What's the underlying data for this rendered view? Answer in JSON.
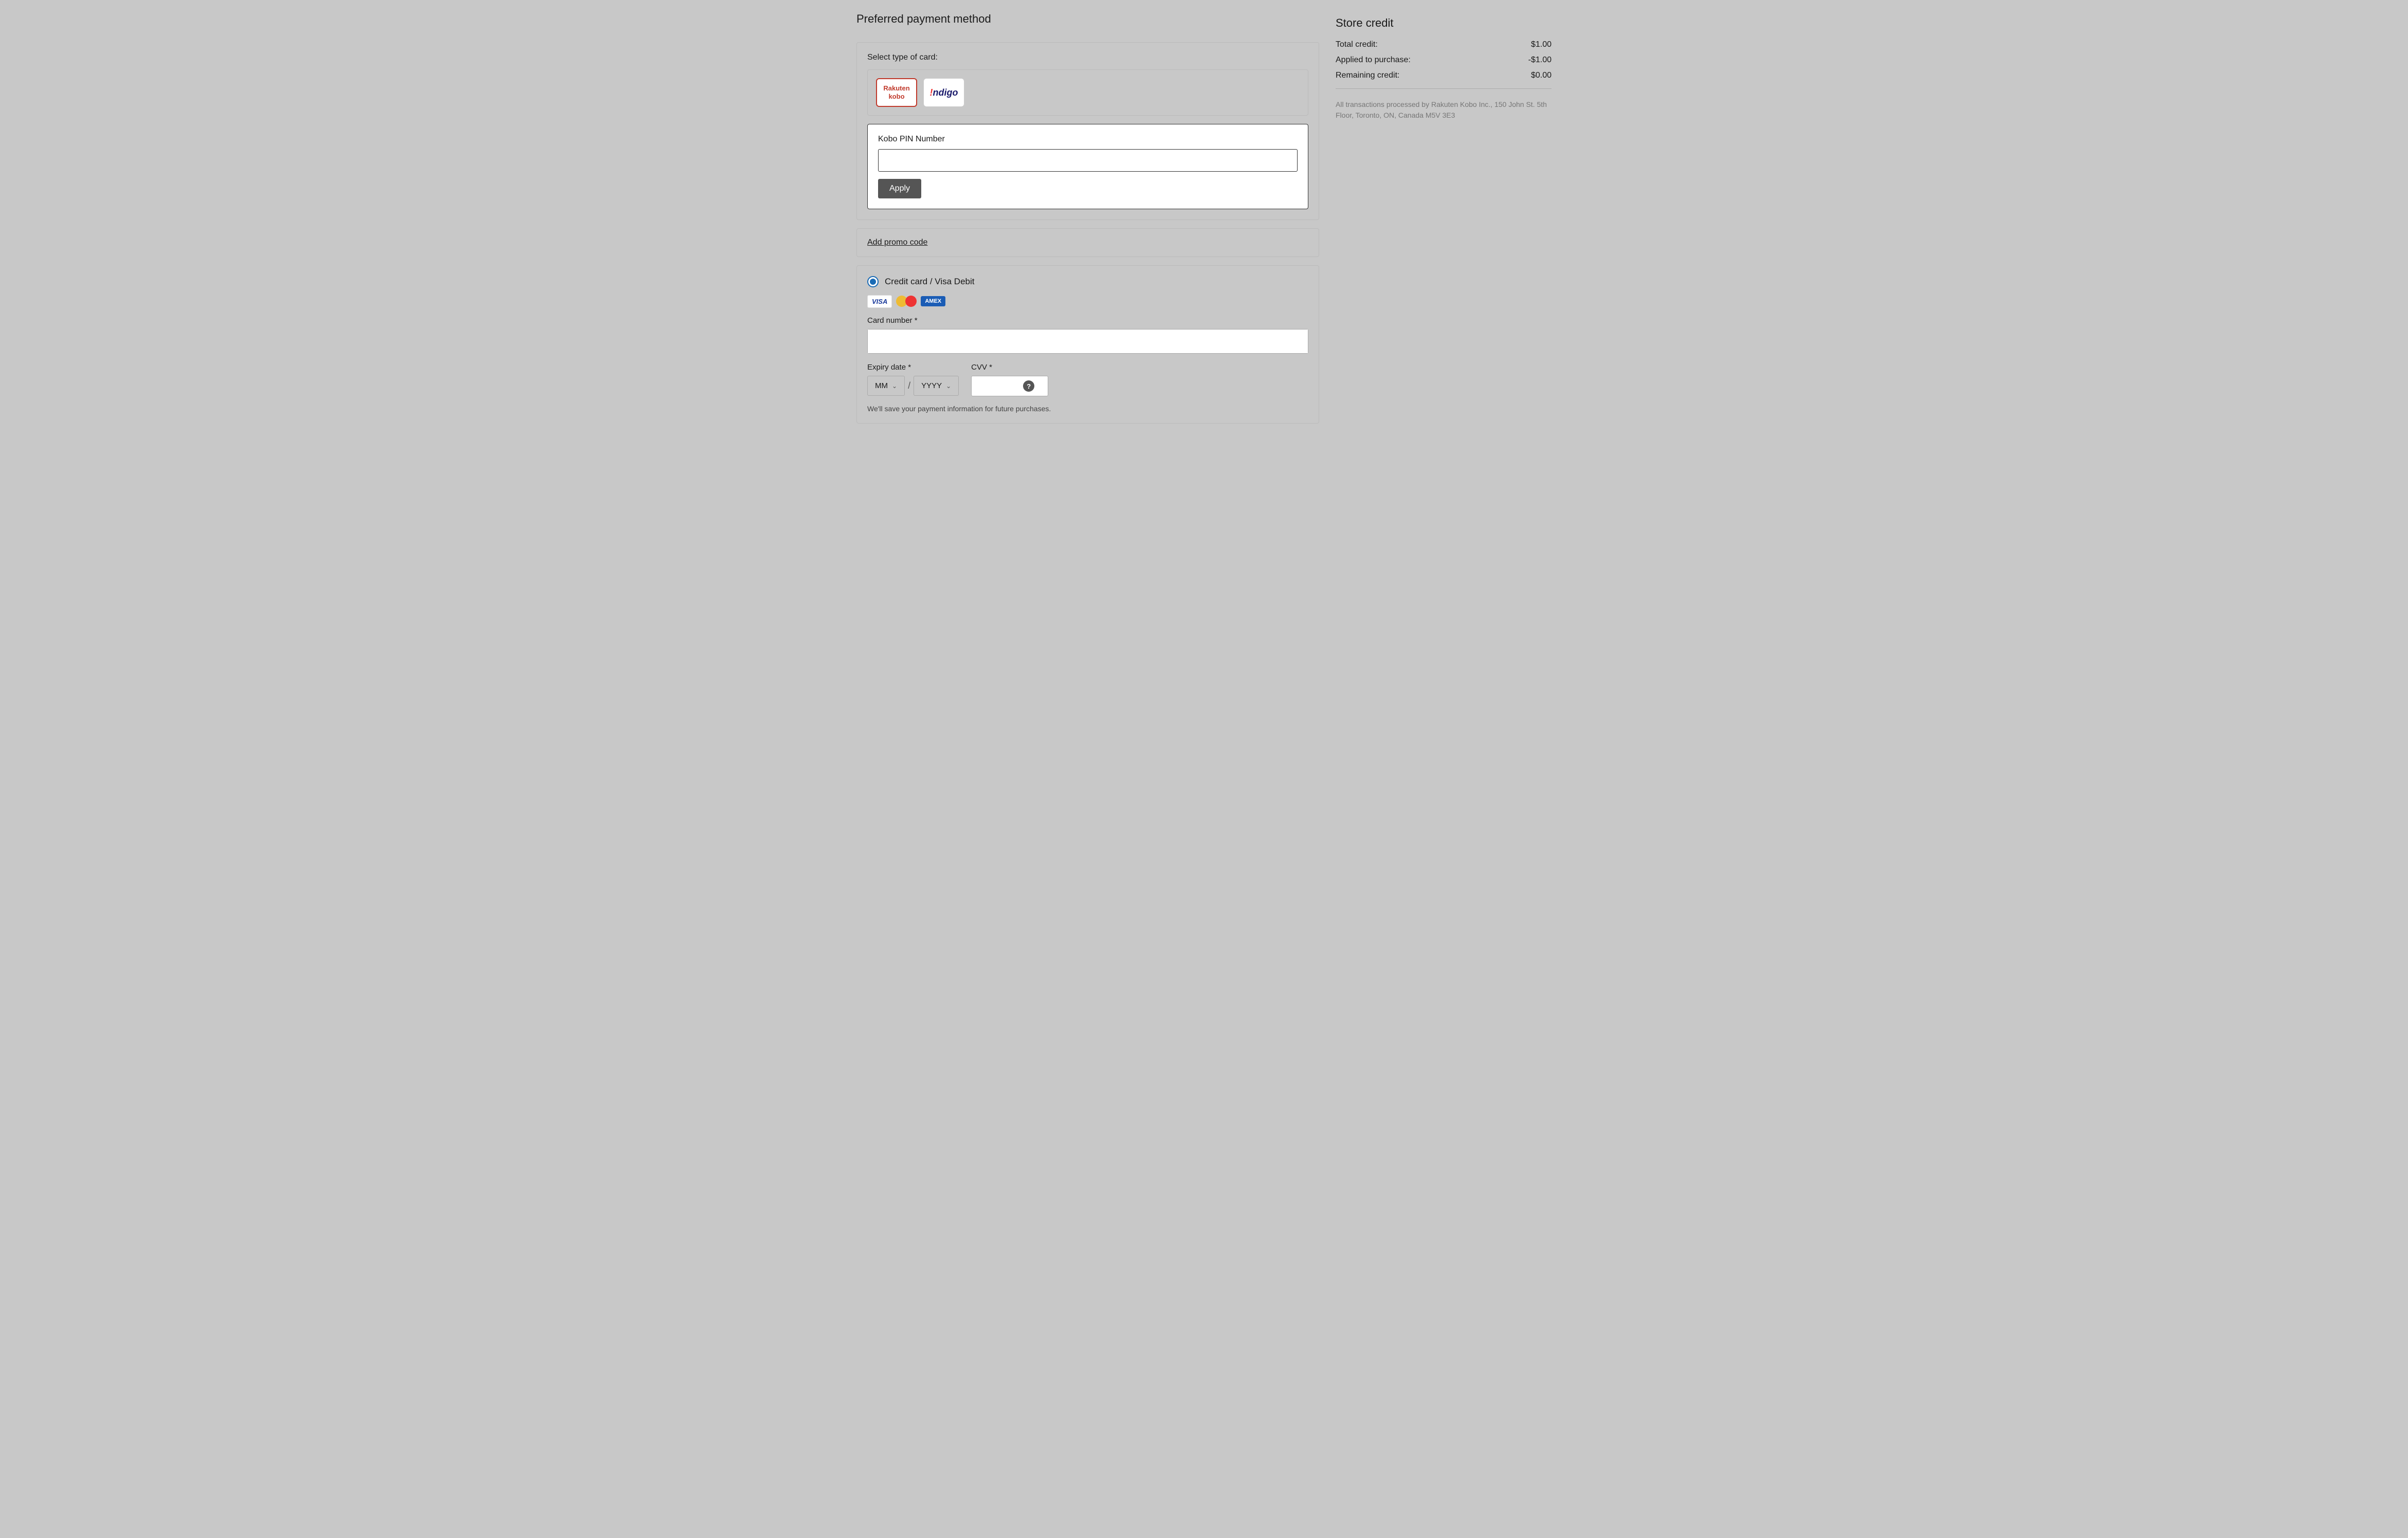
{
  "left": {
    "section_title": "Preferred payment method",
    "card_select_label": "Select type of card:",
    "rakuten_logo_line1": "Rakuten",
    "rakuten_logo_line2": "kobo",
    "indigo_logo": "!ndigo",
    "pin_section": {
      "label": "Kobo PIN Number",
      "placeholder": "",
      "apply_button": "Apply"
    },
    "promo": {
      "link_text": "Add promo code"
    },
    "credit_card": {
      "radio_label": "Credit card / Visa Debit",
      "card_number_label": "Card number *",
      "expiry_label": "Expiry date *",
      "expiry_month_placeholder": "MM",
      "expiry_year_placeholder": "YYYY",
      "cvv_label": "CVV *",
      "save_text": "We'll save your payment information for future purchases."
    }
  },
  "right": {
    "store_credit_title": "Store credit",
    "rows": [
      {
        "label": "Total credit:",
        "value": "$1.00"
      },
      {
        "label": "Applied to purchase:",
        "value": "-$1.00"
      },
      {
        "label": "Remaining credit:",
        "value": "$0.00"
      }
    ],
    "transaction_text": "All transactions processed by Rakuten Kobo Inc., 150 John St. 5th Floor, Toronto, ON, Canada M5V 3E3"
  }
}
